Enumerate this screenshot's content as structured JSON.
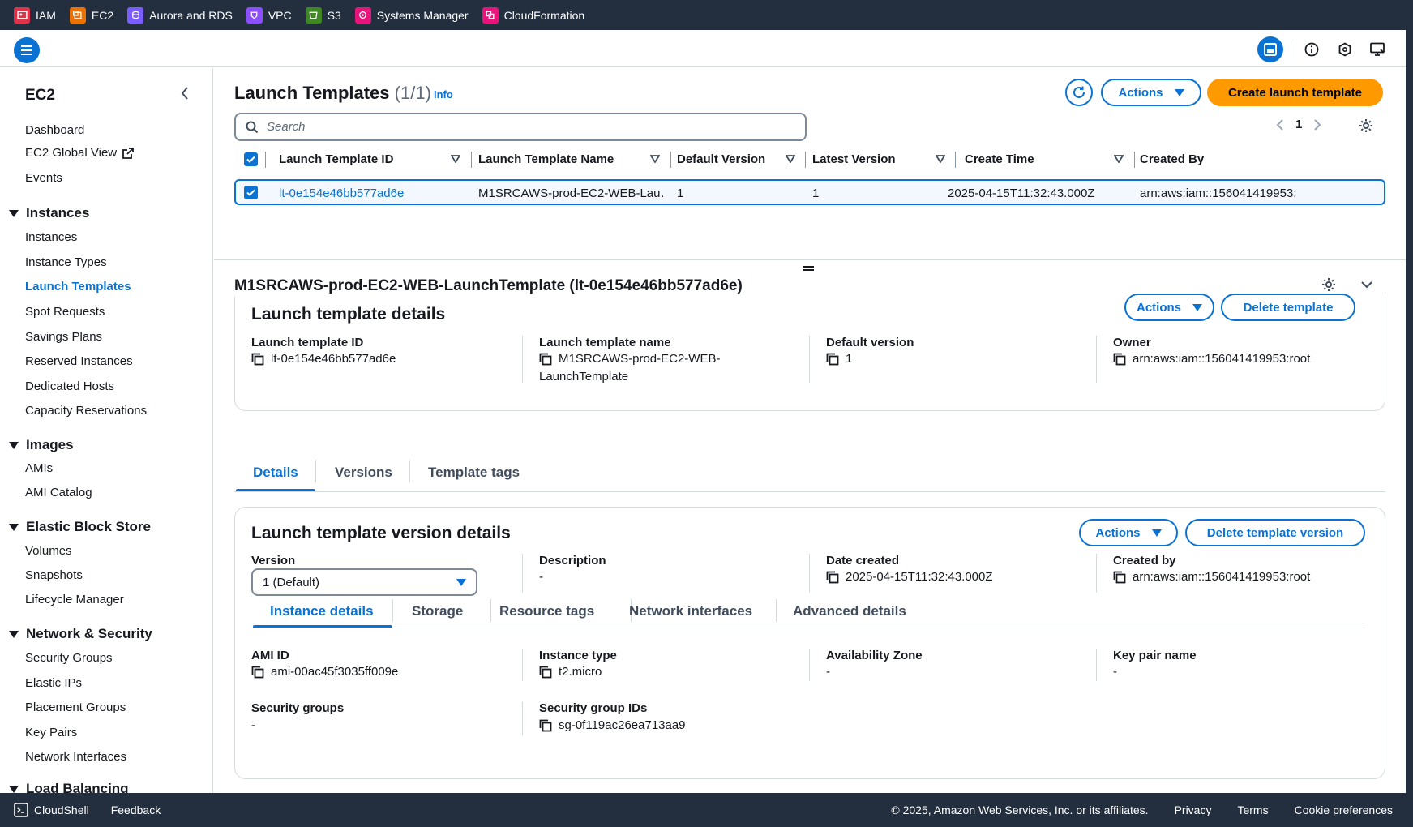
{
  "topbar": {
    "services": [
      {
        "label": "IAM",
        "color": "#dd344c"
      },
      {
        "label": "EC2",
        "color": "#ed7100"
      },
      {
        "label": "Aurora and RDS",
        "color": "#7b5cff"
      },
      {
        "label": "VPC",
        "color": "#8c4fff"
      },
      {
        "label": "S3",
        "color": "#3f8624"
      },
      {
        "label": "Systems Manager",
        "color": "#e7157b"
      },
      {
        "label": "CloudFormation",
        "color": "#e7157b"
      }
    ]
  },
  "sidebar": {
    "title": "EC2",
    "items_top": [
      "Dashboard",
      "EC2 Global View",
      "Events"
    ],
    "sections": [
      {
        "title": "Instances",
        "items": [
          "Instances",
          "Instance Types",
          "Launch Templates",
          "Spot Requests",
          "Savings Plans",
          "Reserved Instances",
          "Dedicated Hosts",
          "Capacity Reservations"
        ]
      },
      {
        "title": "Images",
        "items": [
          "AMIs",
          "AMI Catalog"
        ]
      },
      {
        "title": "Elastic Block Store",
        "items": [
          "Volumes",
          "Snapshots",
          "Lifecycle Manager"
        ]
      },
      {
        "title": "Network & Security",
        "items": [
          "Security Groups",
          "Elastic IPs",
          "Placement Groups",
          "Key Pairs",
          "Network Interfaces"
        ]
      },
      {
        "title": "Load Balancing",
        "items": []
      }
    ],
    "active_item": "Launch Templates"
  },
  "list": {
    "title": "Launch Templates",
    "count": "(1/1)",
    "info": "Info",
    "actions_label": "Actions",
    "create_label": "Create launch template",
    "search_placeholder": "Search",
    "page": "1",
    "columns": [
      "Launch Template ID",
      "Launch Template Name",
      "Default Version",
      "Latest Version",
      "Create Time",
      "Created By"
    ],
    "rows": [
      {
        "id": "lt-0e154e46bb577ad6e",
        "name": "M1SRCAWS-prod-EC2-WEB-Lau…",
        "default_version": "1",
        "latest_version": "1",
        "create_time": "2025-04-15T11:32:43.000Z",
        "created_by": "arn:aws:iam::156041419953:"
      }
    ]
  },
  "detail": {
    "title": "M1SRCAWS-prod-EC2-WEB-LaunchTemplate (lt-0e154e46bb577ad6e)",
    "card1": {
      "heading": "Launch template details",
      "actions_label": "Actions",
      "delete_label": "Delete template",
      "fields": [
        {
          "label": "Launch template ID",
          "value": "lt-0e154e46bb577ad6e"
        },
        {
          "label": "Launch template name",
          "value": "M1SRCAWS-prod-EC2-WEB-",
          "value2": "LaunchTemplate"
        },
        {
          "label": "Default version",
          "value": "1"
        },
        {
          "label": "Owner",
          "value": "arn:aws:iam::156041419953:root"
        }
      ]
    },
    "tabs": [
      "Details",
      "Versions",
      "Template tags"
    ],
    "card2": {
      "heading": "Launch template version details",
      "actions_label": "Actions",
      "delete_label": "Delete template version",
      "version_label": "Version",
      "version_value": "1 (Default)",
      "description_label": "Description",
      "description_value": "-",
      "date_label": "Date created",
      "date_value": "2025-04-15T11:32:43.000Z",
      "created_by_label": "Created by",
      "created_by_value": "arn:aws:iam::156041419953:root",
      "subtabs": [
        "Instance details",
        "Storage",
        "Resource tags",
        "Network interfaces",
        "Advanced details"
      ],
      "ami_label": "AMI ID",
      "ami_value": "ami-00ac45f3035ff009e",
      "itype_label": "Instance type",
      "itype_value": "t2.micro",
      "az_label": "Availability Zone",
      "az_value": "-",
      "key_label": "Key pair name",
      "key_value": "-",
      "sg_label": "Security groups",
      "sg_value": "-",
      "sgid_label": "Security group IDs",
      "sgid_value": "sg-0f119ac26ea713aa9"
    }
  },
  "footer": {
    "cloudshell": "CloudShell",
    "feedback": "Feedback",
    "copyright": "© 2025, Amazon Web Services, Inc. or its affiliates.",
    "privacy": "Privacy",
    "terms": "Terms",
    "cookies": "Cookie preferences"
  }
}
